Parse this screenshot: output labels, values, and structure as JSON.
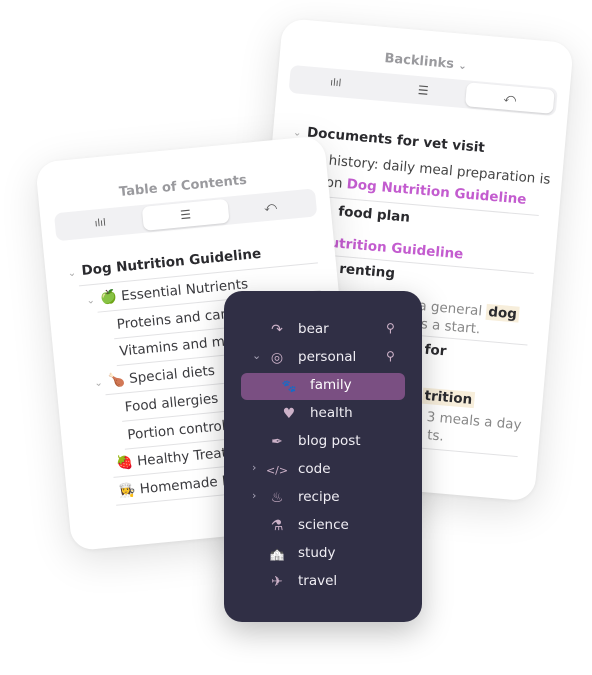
{
  "backlinks_card": {
    "title": "Backlinks",
    "title_chevron": "⌄",
    "tabs": [
      {
        "icon": "stats-icon",
        "glyph": "ılıl"
      },
      {
        "icon": "list-icon",
        "glyph": "☰"
      },
      {
        "icon": "backlink-icon",
        "glyph": "⤺"
      }
    ],
    "selected_tab": 2,
    "section_heading": "Documents for vet visit",
    "lines": {
      "l1": "history: daily meal preparation is",
      "l2_prefix": "d on ",
      "l2_link": "Dog Nutrition Guideline",
      "l3": "food plan",
      "l4_link": "utrition Guideline",
      "l5": "renting",
      "l6_prefix": "a general ",
      "l6_mark": "dog",
      "l7": "s a start.",
      "l8": "for",
      "l9_mark": "trition",
      "l10": "3 meals a day",
      "l11": "ts."
    }
  },
  "toc_card": {
    "title": "Table of Contents",
    "tabs": [
      {
        "icon": "stats-icon",
        "glyph": "ılıl"
      },
      {
        "icon": "list-icon",
        "glyph": "☰"
      },
      {
        "icon": "backlink-icon",
        "glyph": "⤺"
      }
    ],
    "selected_tab": 1,
    "root": "Dog Nutrition Guideline",
    "items": [
      {
        "label": "Essential Nutrients",
        "emoji": "🍏"
      },
      {
        "label": "Proteins and carb"
      },
      {
        "label": "Vitamins and min"
      },
      {
        "label": "Special diets",
        "emoji": "🍗"
      },
      {
        "label": "Food allergies"
      },
      {
        "label": "Portion control"
      },
      {
        "label": "Healthy Treats",
        "emoji": "🍓"
      },
      {
        "label": "Homemade Re",
        "emoji": "👩‍🍳"
      }
    ]
  },
  "sidebar": {
    "accent": "#7a4f82",
    "items": [
      {
        "label": "bear",
        "icon": "bear-icon",
        "glyph": "↷",
        "pinned": true
      },
      {
        "label": "personal",
        "icon": "head-spiral-icon",
        "glyph": "◎",
        "pinned": true,
        "expanded": true
      },
      {
        "label": "family",
        "icon": "paw-icon",
        "glyph": "🐾",
        "selected": true
      },
      {
        "label": "health",
        "icon": "heart-pulse-icon",
        "glyph": "♥"
      },
      {
        "label": "blog post",
        "icon": "feather-icon",
        "glyph": "✒"
      },
      {
        "label": "code",
        "icon": "code-icon",
        "glyph": "</>",
        "collapsed": true
      },
      {
        "label": "recipe",
        "icon": "pot-icon",
        "glyph": "♨",
        "collapsed": true
      },
      {
        "label": "science",
        "icon": "flask-icon",
        "glyph": "⚗"
      },
      {
        "label": "study",
        "icon": "school-icon",
        "glyph": "🏫"
      },
      {
        "label": "travel",
        "icon": "airplane-icon",
        "glyph": "✈"
      }
    ],
    "pin_glyph": "⚲",
    "chevron_down": "⌄",
    "chevron_right": "›"
  }
}
